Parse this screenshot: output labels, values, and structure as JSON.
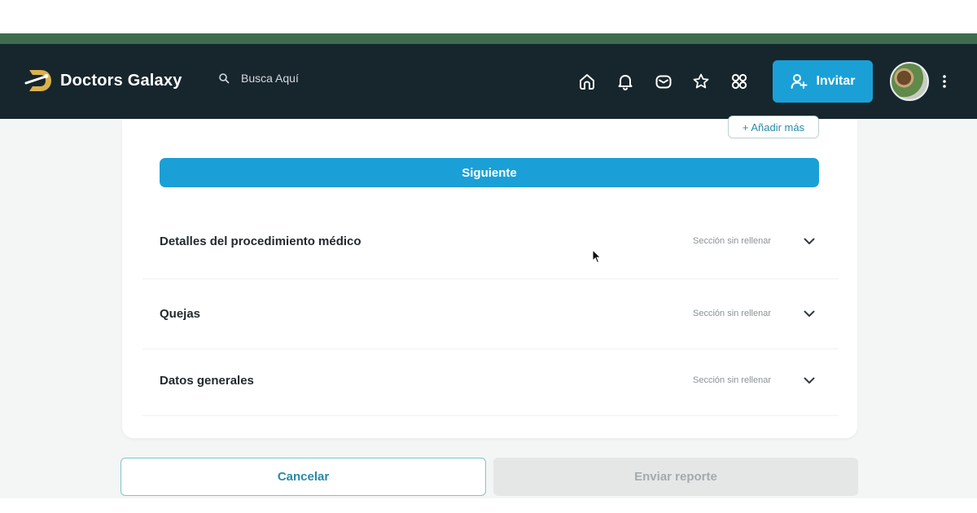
{
  "app": {
    "brand": "Doctors Galaxy"
  },
  "header": {
    "search_placeholder": "Busca Aquí",
    "icons": [
      "home-icon",
      "bell-icon",
      "mail-icon",
      "star-icon",
      "apps-icon"
    ],
    "invite_label": "Invitar"
  },
  "form": {
    "add_more_label": "+ Añadir más",
    "next_label": "Siguiente",
    "sections": [
      {
        "title": "Detalles del procedimiento médico",
        "status": "Sección sin rellenar"
      },
      {
        "title": "Quejas",
        "status": "Sección sin rellenar"
      },
      {
        "title": "Datos generales",
        "status": "Sección sin rellenar"
      }
    ]
  },
  "footer": {
    "cancel_label": "Cancelar",
    "send_label": "Enviar reporte"
  },
  "colors": {
    "navbar": "#17262d",
    "accent": "#1aa0d6",
    "brand_strip": "#3f6c4e",
    "logo_gold": "#d9b24c"
  }
}
